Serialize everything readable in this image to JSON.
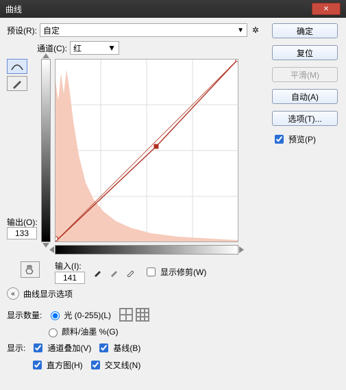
{
  "title": "曲线",
  "preset": {
    "label": "预设(R):",
    "value": "自定"
  },
  "channel": {
    "label": "通道(C):",
    "value": "红"
  },
  "output": {
    "label": "输出(O):",
    "value": "133"
  },
  "input": {
    "label": "输入(I):",
    "value": "141"
  },
  "show_clip": "显示修剪(W)",
  "disclosure": "曲线显示选项",
  "amount": {
    "label": "显示数量:",
    "opt_light": "光 (0-255)(L)",
    "opt_pigment": "颜料/油墨 %(G)"
  },
  "show": {
    "label": "显示:",
    "overlay": "通道叠加(V)",
    "baseline": "基线(B)",
    "histogram": "直方图(H)",
    "intersection": "交叉线(N)"
  },
  "buttons": {
    "ok": "确定",
    "reset": "复位",
    "smooth": "平滑(M)",
    "auto": "自动(A)",
    "options": "选项(T)..."
  },
  "preview": "预览(P)",
  "chart_data": {
    "type": "line",
    "title": "",
    "xlabel": "输入",
    "ylabel": "输出",
    "xlim": [
      0,
      255
    ],
    "ylim": [
      0,
      255
    ],
    "series": [
      {
        "name": "红",
        "points": [
          [
            0,
            0
          ],
          [
            141,
            133
          ],
          [
            255,
            255
          ]
        ]
      }
    ],
    "selected_point": [
      141,
      133
    ],
    "histogram_hint": "left-heavy red channel histogram"
  }
}
